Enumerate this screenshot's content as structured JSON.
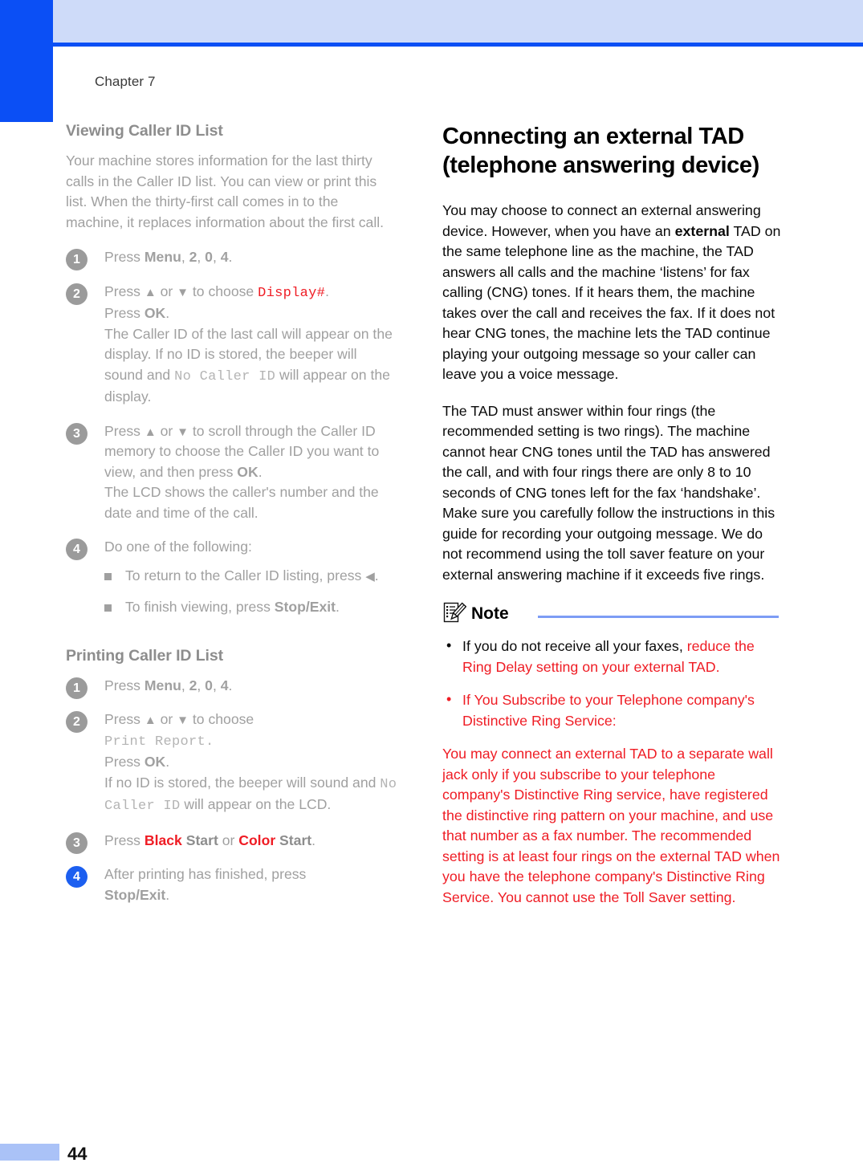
{
  "page": {
    "chapter_label": "Chapter 7",
    "page_number": "44",
    "accent_blue": "#0b4ff5",
    "header_band": "#cedbf9",
    "footer_bar": "#aac2f7",
    "gray_text": "#a0a0a0",
    "red_text": "#ef1c24",
    "step_badge_gray": "#9b9b9b",
    "step_badge_blue": "#1c5ff0"
  },
  "left_column": {
    "section1": {
      "heading": "Viewing Caller ID List",
      "intro": "Your machine stores information for the last thirty calls in the Caller ID list. You can view or print this list. When the thirty-first call comes in to the machine, it replaces information about the first call.",
      "steps": [
        {
          "number": "1",
          "badge_color": "gray",
          "line1_pre": "Press ",
          "line1_bold1": "Menu",
          "line1_sep1": ", ",
          "line1_bold2": "2",
          "line1_sep2": ", ",
          "line1_bold3": "0",
          "line1_sep3": ", ",
          "line1_bold4": "4",
          "line1_end": "."
        },
        {
          "number": "2",
          "badge_color": "gray",
          "t1": "Press ",
          "t2": " or ",
          "t3": " to choose ",
          "mono_red": "Display#",
          "t4": ".",
          "l2_pre": "Press ",
          "l2_bold": "OK",
          "l2_end": ".",
          "l3": "The Caller ID of the last call will appear on the display. If no ID is stored, the beeper will sound and ",
          "l3_mono": "No Caller ID",
          "l4": " will appear on the display."
        },
        {
          "number": "3",
          "badge_color": "gray",
          "t1": "Press ",
          "t2": " or ",
          "t3": " to scroll through the Caller ID memory to choose the Caller ID you want to view, and then press ",
          "t_bold": "OK",
          "t4": ".",
          "l2": "The LCD shows the caller's number and the date and time of the call."
        },
        {
          "number": "4",
          "badge_color": "gray",
          "t1": "Do one of the following:",
          "bullets": [
            {
              "pre": "To return to the Caller ID listing, press ",
              "arrow": "◀",
              "post": "."
            },
            {
              "pre": "To finish viewing, press ",
              "bold": "Stop/Exit",
              "post": "."
            }
          ]
        }
      ]
    },
    "section2": {
      "heading": "Printing Caller ID List",
      "steps": [
        {
          "number": "1",
          "badge_color": "gray",
          "line1_pre": "Press ",
          "line1_bold1": "Menu",
          "line1_sep1": ", ",
          "line1_bold2": "2",
          "line1_sep2": ", ",
          "line1_bold3": "0",
          "line1_sep3": ", ",
          "line1_bold4": "4",
          "line1_end": "."
        },
        {
          "number": "2",
          "badge_color": "gray",
          "t1": "Press ",
          "t2": " or ",
          "t3": " to choose",
          "mono_gray": "Print Report.",
          "l2_pre": "Press ",
          "l2_bold": "OK",
          "l2_end": ".",
          "l3": "If no ID is stored, the beeper will sound and ",
          "l3_mono": "No Caller ID",
          "l4": " will appear on the LCD."
        },
        {
          "number": "3",
          "badge_color": "gray",
          "pre": "Press ",
          "red1": "Black",
          "mid1": " Start",
          "sep": " or ",
          "red2": "Color",
          "mid2": " Start",
          "post": "."
        },
        {
          "number": "4",
          "badge_color": "blue",
          "t1": "After printing has finished, press ",
          "bold": "Stop/Exit",
          "post": "."
        }
      ]
    }
  },
  "right_column": {
    "heading": "Connecting an external TAD (telephone answering device)",
    "para1_a": "You may choose to connect an external answering device. However, when you have an ",
    "para1_bold": "external",
    "para1_b": " TAD on the same telephone line as the machine, the TAD answers all calls and the machine ‘listens’ for fax calling (CNG) tones. If it hears them, the machine takes over the call and receives the fax. If it does not hear CNG tones, the machine lets the TAD continue playing your outgoing message so your caller can leave you a voice message.",
    "para2": "The TAD must answer within four rings (the recommended setting is two rings). The machine cannot hear CNG tones until the TAD has answered the call, and with four rings there are only 8 to 10 seconds of CNG tones left for the fax ‘handshake’. Make sure you carefully follow the instructions in this guide for recording your outgoing message. We do not recommend using the toll saver feature on your external answering machine if it exceeds five rings.",
    "note": {
      "label": "Note",
      "icon": "note-pencil-icon",
      "items": [
        {
          "style": "black",
          "black_part": "If you do not receive all your faxes, ",
          "red_part": "reduce the Ring Delay setting on your external TAD."
        },
        {
          "style": "red",
          "red_part": "If You Subscribe to your Telephone company's Distinctive Ring Service:"
        }
      ],
      "sub_paragraph": "You may connect an external TAD to a separate wall jack only if you subscribe to your telephone company's Distinctive Ring service, have registered the distinctive ring pattern on your machine, and use that number as a fax number. The recommended setting is at least four rings on the external TAD when you have the telephone company's Distinctive Ring Service. You cannot use the Toll Saver setting."
    }
  }
}
